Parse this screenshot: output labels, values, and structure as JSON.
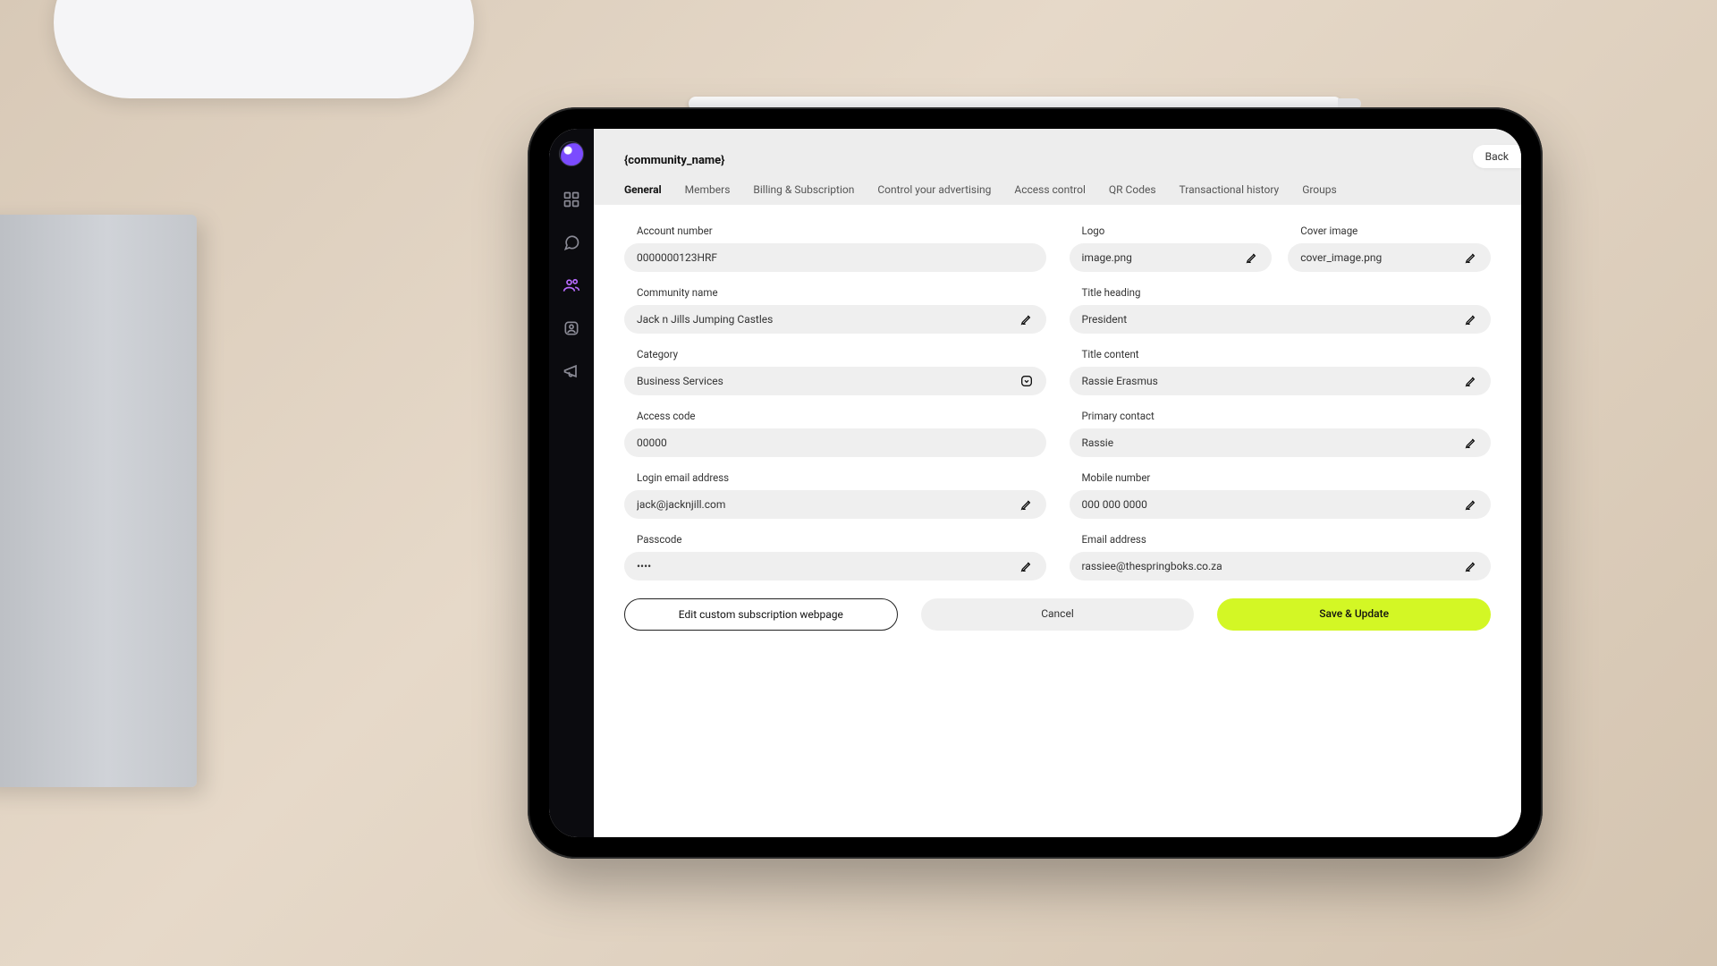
{
  "header": {
    "page_title": "{community_name}",
    "back_label": "Back"
  },
  "tabs": [
    "General",
    "Members",
    "Billing & Subscription",
    "Control your advertising",
    "Access control",
    "QR Codes",
    "Transactional history",
    "Groups"
  ],
  "sidebar": {
    "icons": [
      "grid-icon",
      "chat-icon",
      "users-icon",
      "profile-icon",
      "announce-icon"
    ]
  },
  "left": {
    "account_number": {
      "label": "Account number",
      "value": "0000000123HRF"
    },
    "community_name": {
      "label": "Community name",
      "value": "Jack n Jills Jumping Castles"
    },
    "category": {
      "label": "Category",
      "value": "Business Services"
    },
    "access_code": {
      "label": "Access code",
      "value": "00000"
    },
    "login_email": {
      "label": "Login email address",
      "value": "jack@jacknjill.com"
    },
    "passcode": {
      "label": "Passcode",
      "value": "••••"
    }
  },
  "right": {
    "logo": {
      "label": "Logo",
      "value": "image.png"
    },
    "cover": {
      "label": "Cover image",
      "value": "cover_image.png"
    },
    "title_heading": {
      "label": "Title heading",
      "value": "President"
    },
    "title_content": {
      "label": "Title content",
      "value": "Rassie Erasmus"
    },
    "primary_contact": {
      "label": "Primary contact",
      "value": "Rassie"
    },
    "mobile": {
      "label": "Mobile number",
      "value": "000 000 0000"
    },
    "email": {
      "label": "Email address",
      "value": "rassiee@thespringboks.co.za"
    }
  },
  "footer": {
    "edit_webpage": "Edit custom subscription webpage",
    "cancel": "Cancel",
    "save": "Save & Update"
  },
  "colors": {
    "accent": "#d3f725",
    "sidebar_active": "#b96bff"
  }
}
